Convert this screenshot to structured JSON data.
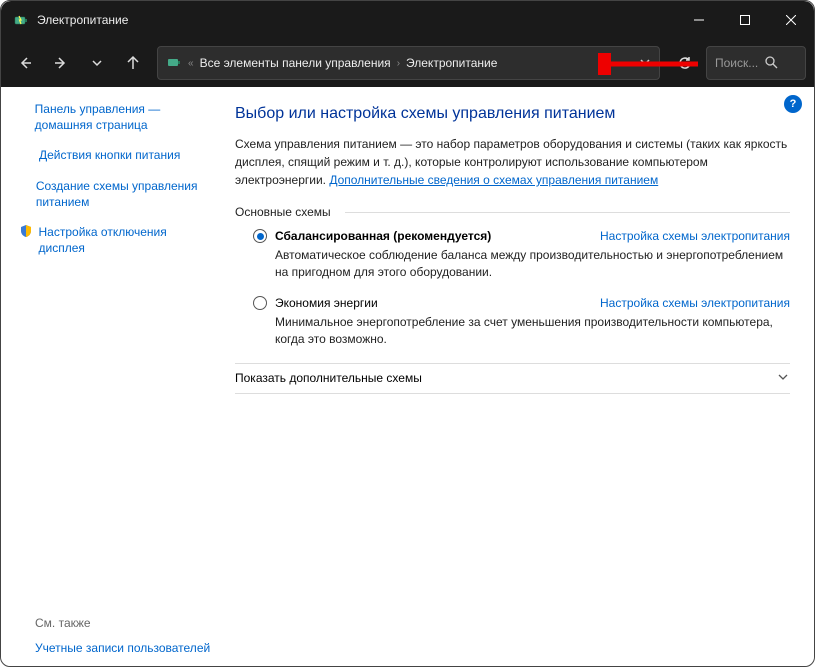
{
  "window": {
    "title": "Электропитание"
  },
  "breadcrumb": {
    "item1": "Все элементы панели управления",
    "item2": "Электропитание"
  },
  "search": {
    "placeholder": "Поиск..."
  },
  "sidebar": {
    "home": "Панель управления — домашняя страница",
    "link1": "Действия кнопки питания",
    "link2": "Создание схемы управления питанием",
    "link3": "Настройка отключения дисплея",
    "see_also_h": "См. также",
    "see_also_link": "Учетные записи пользователей"
  },
  "main": {
    "heading": "Выбор или настройка схемы управления питанием",
    "desc_pre": "Схема управления питанием — это набор параметров оборудования и системы (таких как яркость дисплея, спящий режим и т. д.), которые контролируют использование компьютером электроэнергии. ",
    "desc_link": "Дополнительные сведения о схемах управления питанием",
    "fieldset_label": "Основные схемы",
    "plan1": {
      "name": "Сбалансированная (рекомендуется)",
      "settings": "Настройка схемы электропитания",
      "desc": "Автоматическое соблюдение баланса между производительностью и энергопотреблением на пригодном для этого оборудовании."
    },
    "plan2": {
      "name": "Экономия энергии",
      "settings": "Настройка схемы электропитания",
      "desc": "Минимальное энергопотребление за счет уменьшения производительности компьютера, когда это возможно."
    },
    "expander": "Показать дополнительные схемы"
  }
}
